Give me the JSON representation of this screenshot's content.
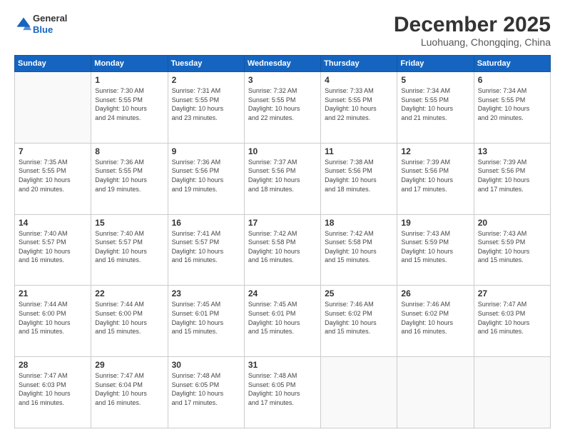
{
  "logo": {
    "general": "General",
    "blue": "Blue"
  },
  "header": {
    "month": "December 2025",
    "location": "Luohuang, Chongqing, China"
  },
  "weekdays": [
    "Sunday",
    "Monday",
    "Tuesday",
    "Wednesday",
    "Thursday",
    "Friday",
    "Saturday"
  ],
  "weeks": [
    [
      {
        "day": "",
        "info": ""
      },
      {
        "day": "1",
        "info": "Sunrise: 7:30 AM\nSunset: 5:55 PM\nDaylight: 10 hours\nand 24 minutes."
      },
      {
        "day": "2",
        "info": "Sunrise: 7:31 AM\nSunset: 5:55 PM\nDaylight: 10 hours\nand 23 minutes."
      },
      {
        "day": "3",
        "info": "Sunrise: 7:32 AM\nSunset: 5:55 PM\nDaylight: 10 hours\nand 22 minutes."
      },
      {
        "day": "4",
        "info": "Sunrise: 7:33 AM\nSunset: 5:55 PM\nDaylight: 10 hours\nand 22 minutes."
      },
      {
        "day": "5",
        "info": "Sunrise: 7:34 AM\nSunset: 5:55 PM\nDaylight: 10 hours\nand 21 minutes."
      },
      {
        "day": "6",
        "info": "Sunrise: 7:34 AM\nSunset: 5:55 PM\nDaylight: 10 hours\nand 20 minutes."
      }
    ],
    [
      {
        "day": "7",
        "info": "Sunrise: 7:35 AM\nSunset: 5:55 PM\nDaylight: 10 hours\nand 20 minutes."
      },
      {
        "day": "8",
        "info": "Sunrise: 7:36 AM\nSunset: 5:55 PM\nDaylight: 10 hours\nand 19 minutes."
      },
      {
        "day": "9",
        "info": "Sunrise: 7:36 AM\nSunset: 5:56 PM\nDaylight: 10 hours\nand 19 minutes."
      },
      {
        "day": "10",
        "info": "Sunrise: 7:37 AM\nSunset: 5:56 PM\nDaylight: 10 hours\nand 18 minutes."
      },
      {
        "day": "11",
        "info": "Sunrise: 7:38 AM\nSunset: 5:56 PM\nDaylight: 10 hours\nand 18 minutes."
      },
      {
        "day": "12",
        "info": "Sunrise: 7:39 AM\nSunset: 5:56 PM\nDaylight: 10 hours\nand 17 minutes."
      },
      {
        "day": "13",
        "info": "Sunrise: 7:39 AM\nSunset: 5:56 PM\nDaylight: 10 hours\nand 17 minutes."
      }
    ],
    [
      {
        "day": "14",
        "info": "Sunrise: 7:40 AM\nSunset: 5:57 PM\nDaylight: 10 hours\nand 16 minutes."
      },
      {
        "day": "15",
        "info": "Sunrise: 7:40 AM\nSunset: 5:57 PM\nDaylight: 10 hours\nand 16 minutes."
      },
      {
        "day": "16",
        "info": "Sunrise: 7:41 AM\nSunset: 5:57 PM\nDaylight: 10 hours\nand 16 minutes."
      },
      {
        "day": "17",
        "info": "Sunrise: 7:42 AM\nSunset: 5:58 PM\nDaylight: 10 hours\nand 16 minutes."
      },
      {
        "day": "18",
        "info": "Sunrise: 7:42 AM\nSunset: 5:58 PM\nDaylight: 10 hours\nand 15 minutes."
      },
      {
        "day": "19",
        "info": "Sunrise: 7:43 AM\nSunset: 5:59 PM\nDaylight: 10 hours\nand 15 minutes."
      },
      {
        "day": "20",
        "info": "Sunrise: 7:43 AM\nSunset: 5:59 PM\nDaylight: 10 hours\nand 15 minutes."
      }
    ],
    [
      {
        "day": "21",
        "info": "Sunrise: 7:44 AM\nSunset: 6:00 PM\nDaylight: 10 hours\nand 15 minutes."
      },
      {
        "day": "22",
        "info": "Sunrise: 7:44 AM\nSunset: 6:00 PM\nDaylight: 10 hours\nand 15 minutes."
      },
      {
        "day": "23",
        "info": "Sunrise: 7:45 AM\nSunset: 6:01 PM\nDaylight: 10 hours\nand 15 minutes."
      },
      {
        "day": "24",
        "info": "Sunrise: 7:45 AM\nSunset: 6:01 PM\nDaylight: 10 hours\nand 15 minutes."
      },
      {
        "day": "25",
        "info": "Sunrise: 7:46 AM\nSunset: 6:02 PM\nDaylight: 10 hours\nand 15 minutes."
      },
      {
        "day": "26",
        "info": "Sunrise: 7:46 AM\nSunset: 6:02 PM\nDaylight: 10 hours\nand 16 minutes."
      },
      {
        "day": "27",
        "info": "Sunrise: 7:47 AM\nSunset: 6:03 PM\nDaylight: 10 hours\nand 16 minutes."
      }
    ],
    [
      {
        "day": "28",
        "info": "Sunrise: 7:47 AM\nSunset: 6:03 PM\nDaylight: 10 hours\nand 16 minutes."
      },
      {
        "day": "29",
        "info": "Sunrise: 7:47 AM\nSunset: 6:04 PM\nDaylight: 10 hours\nand 16 minutes."
      },
      {
        "day": "30",
        "info": "Sunrise: 7:48 AM\nSunset: 6:05 PM\nDaylight: 10 hours\nand 17 minutes."
      },
      {
        "day": "31",
        "info": "Sunrise: 7:48 AM\nSunset: 6:05 PM\nDaylight: 10 hours\nand 17 minutes."
      },
      {
        "day": "",
        "info": ""
      },
      {
        "day": "",
        "info": ""
      },
      {
        "day": "",
        "info": ""
      }
    ]
  ]
}
